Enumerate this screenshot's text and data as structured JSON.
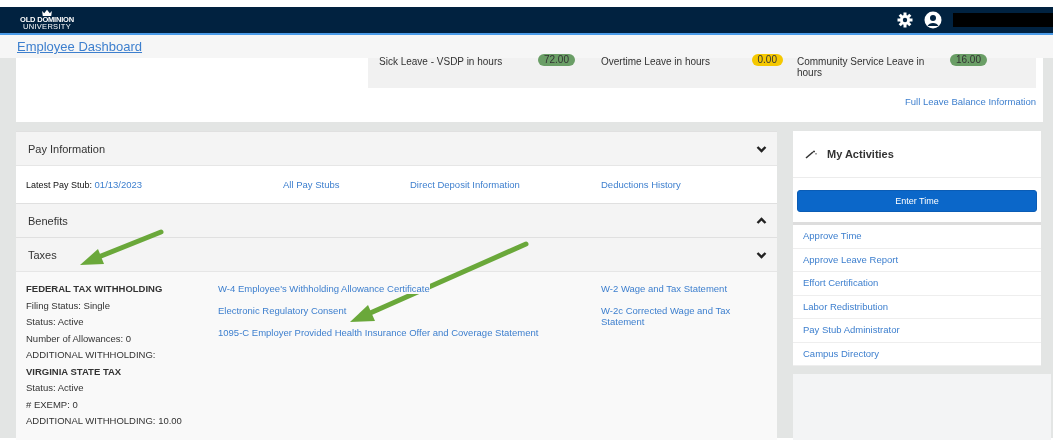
{
  "header": {
    "logo_text": "OLD DOMINION",
    "logo_subtext": "UNIVERSITY"
  },
  "breadcrumb": "Employee Dashboard",
  "leave_balances": [
    {
      "label": "Sick Leave - VSDP in hours",
      "value": "72.00",
      "color": "#6a9e66"
    },
    {
      "label": "Overtime Leave in hours",
      "value": "0.00",
      "color": "#f5c800"
    },
    {
      "label": "Community Service Leave in hours",
      "value": "16.00",
      "color": "#6a9e66"
    }
  ],
  "leave_link": "Full Leave Balance Information",
  "panels": [
    {
      "kind": "pay",
      "title": "Pay Information",
      "expanded": true,
      "stub_label": "Latest Pay Stub:",
      "stub_date": "01/13/2023",
      "links": [
        "All Pay Stubs",
        "Direct Deposit Information",
        "Deductions History"
      ]
    },
    {
      "kind": "plain",
      "title": "Benefits",
      "expanded": false
    },
    {
      "kind": "taxes",
      "title": "Taxes",
      "expanded": true,
      "lines": [
        {
          "text": "FEDERAL TAX WITHHOLDING",
          "heading": true
        },
        {
          "text": "Filing Status: Single",
          "heading": false
        },
        {
          "text": "Status: Active",
          "heading": false
        },
        {
          "text": "Number of Allowances: 0",
          "heading": false
        },
        {
          "text": "ADDITIONAL WITHHOLDING:",
          "heading": false
        },
        {
          "text": "VIRGINIA STATE TAX",
          "heading": true
        },
        {
          "text": "Status: Active",
          "heading": false
        },
        {
          "text": "# EXEMP: 0",
          "heading": false
        },
        {
          "text": "ADDITIONAL WITHHOLDING: 10.00",
          "heading": false
        }
      ],
      "links": [
        "W-4 Employee's Withholding Allowance Certificate",
        "Electronic Regulatory Consent",
        "1095-C Employer Provided Health Insurance Offer and Coverage Statement"
      ],
      "links_right": [
        "W-2 Wage and Tax Statement",
        "W-2c Corrected Wage and Tax Statement"
      ]
    }
  ],
  "activities": {
    "title": "My Activities",
    "button": "Enter Time",
    "items": [
      "Approve Time",
      "Approve Leave Report",
      "Effort Certification",
      "Labor Redistribution",
      "Pay Stub Administrator",
      "Campus Directory"
    ]
  }
}
